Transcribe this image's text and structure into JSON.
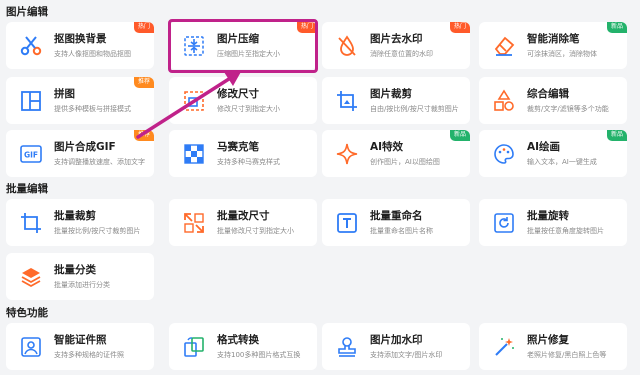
{
  "sections": {
    "image_edit": "图片编辑",
    "batch_edit": "批量编辑",
    "special": "特色功能"
  },
  "accent_colors": {
    "blue": "#2f7cf6",
    "orange": "#ff6a2a",
    "highlight": "#c0228a",
    "hot_badge": "#ff5a2a",
    "recommend_badge": "#ff8a1f",
    "new_badge": "#23b26b"
  },
  "tools": {
    "cutout_bg": {
      "title": "抠图换背景",
      "desc": "支持人像抠图和物品抠图",
      "badge": "热门",
      "icon": "scissors-icon"
    },
    "compress": {
      "title": "图片压缩",
      "desc": "压缩图片至指定大小",
      "badge": "热门",
      "icon": "compress-icon"
    },
    "watermark_remove": {
      "title": "图片去水印",
      "desc": "消除任意位置的水印",
      "badge": "热门",
      "icon": "drop-slash-icon"
    },
    "smart_eraser": {
      "title": "智能消除笔",
      "desc": "可涂抹消区，消除物体",
      "badge": "新品",
      "icon": "eraser-icon"
    },
    "collage": {
      "title": "拼图",
      "desc": "提供多种模板与拼接模式",
      "badge": "推荐",
      "icon": "grid-icon"
    },
    "resize": {
      "title": "修改尺寸",
      "desc": "修改尺寸到指定大小",
      "badge": "",
      "icon": "resize-icon"
    },
    "crop": {
      "title": "图片裁剪",
      "desc": "自由/按比例/按尺寸裁剪图片",
      "badge": "",
      "icon": "crop-icon"
    },
    "comprehensive": {
      "title": "综合编辑",
      "desc": "裁剪/文字/滤镜等多个功能",
      "badge": "",
      "icon": "shapes-icon"
    },
    "gif": {
      "title": "图片合成GIF",
      "desc": "支持调整播放速度、添加文字",
      "badge": "推荐",
      "icon": "gif-icon"
    },
    "mosaic": {
      "title": "马赛克笔",
      "desc": "支持多种马赛克样式",
      "badge": "",
      "icon": "mosaic-icon"
    },
    "ai_effects": {
      "title": "AI特效",
      "desc": "创作图片，AI以图绘图",
      "badge": "新品",
      "icon": "sparkle-icon"
    },
    "ai_paint": {
      "title": "AI绘画",
      "desc": "输入文本，AI一键生成",
      "badge": "新品",
      "icon": "palette-icon"
    },
    "batch_crop": {
      "title": "批量裁剪",
      "desc": "批量按比例/按尺寸裁剪图片",
      "badge": "",
      "icon": "crop-icon"
    },
    "batch_resize": {
      "title": "批量改尺寸",
      "desc": "批量修改尺寸到指定大小",
      "badge": "",
      "icon": "expand-icon"
    },
    "batch_rename": {
      "title": "批量重命名",
      "desc": "批量重命名图片名称",
      "badge": "",
      "icon": "text-t-icon"
    },
    "batch_rotate": {
      "title": "批量旋转",
      "desc": "批量按任意角度旋转图片",
      "badge": "",
      "icon": "rotate-icon"
    },
    "batch_classify": {
      "title": "批量分类",
      "desc": "批量添加进行分类",
      "badge": "",
      "icon": "layers-icon"
    },
    "id_photo": {
      "title": "智能证件照",
      "desc": "支持多种规格的证件照",
      "badge": "",
      "icon": "id-photo-icon"
    },
    "format": {
      "title": "格式转换",
      "desc": "支持100多种图片格式互换",
      "badge": "",
      "icon": "convert-icon"
    },
    "add_watermark": {
      "title": "图片加水印",
      "desc": "支持添加文字/图片水印",
      "badge": "",
      "icon": "stamp-icon"
    },
    "restore": {
      "title": "照片修复",
      "desc": "老照片修复/黑白照上色等",
      "badge": "",
      "icon": "wand-icon"
    }
  }
}
